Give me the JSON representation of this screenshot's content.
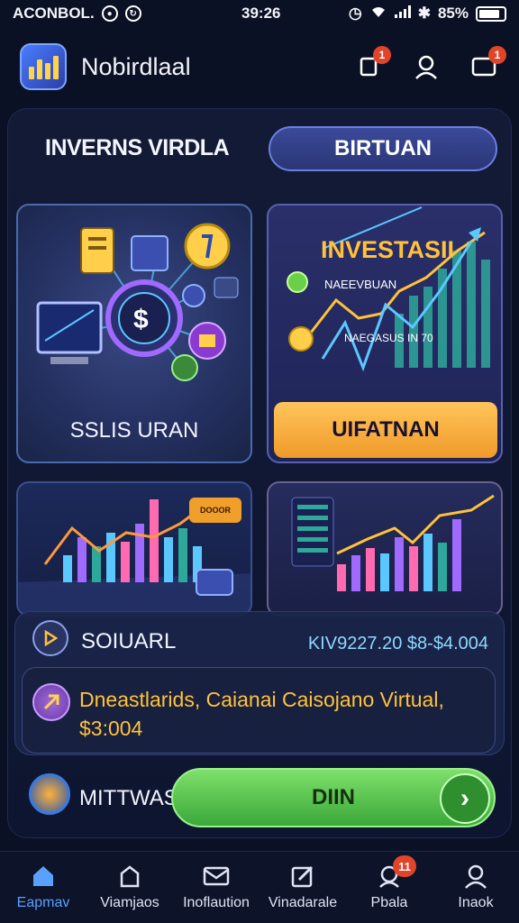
{
  "status_bar": {
    "carrier": "ACONBOL.",
    "time": "39:26",
    "battery": "85%"
  },
  "header": {
    "title": "Nobirdlaal",
    "notifications_badge": "1",
    "messages_badge": "1"
  },
  "section": {
    "title": "INVERNS VIRDLA",
    "toggle_label": "BIRTUAN"
  },
  "cards": {
    "portfolio_label": "SSLIS URAN",
    "portfolio_coin": "$",
    "invest_title": "INVESTASII",
    "invest_subtitle": "NAEEVBUAN",
    "invest_caption": "NAEGASUS IN 70",
    "invest_button": "UIFATNAN",
    "chart_chip": "DOOOR"
  },
  "summary": {
    "label": "SOIUARL",
    "value": "KIV9227.20 $8-$4.004",
    "info_text": "Dneastlarids, Caianai Caisojano Virtual, $3:004"
  },
  "action": {
    "label": "MITTWAS",
    "button_label": "DIIN",
    "arrow": "›"
  },
  "bottom_nav": {
    "items": [
      {
        "label": "Eapmav",
        "icon": "home-icon",
        "active": true
      },
      {
        "label": "Viamjaos",
        "icon": "wallet-icon",
        "active": false
      },
      {
        "label": "Inoflaution",
        "icon": "mail-icon",
        "active": false
      },
      {
        "label": "Vinadarale",
        "icon": "edit-icon",
        "active": false
      },
      {
        "label": "Pbala",
        "icon": "alert-icon",
        "active": false,
        "badge": "11"
      },
      {
        "label": "Inaok",
        "icon": "profile-icon",
        "active": false
      }
    ]
  },
  "colors": {
    "accent_blue": "#5aa0ff",
    "accent_orange": "#ffc23a",
    "accent_green": "#3aa83a",
    "badge_red": "#e0452a"
  }
}
